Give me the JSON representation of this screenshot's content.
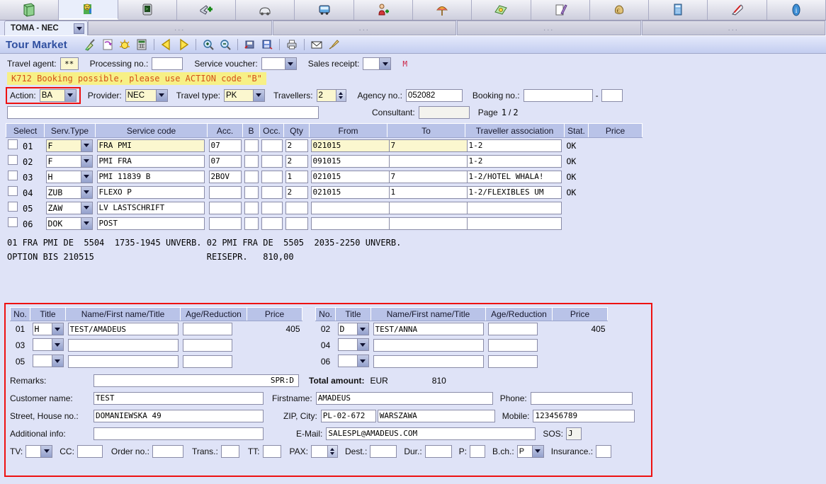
{
  "icon_tabs": [
    {
      "name": "briefcase-icon",
      "active": false
    },
    {
      "name": "smiley-figure-icon",
      "active": true
    },
    {
      "name": "terminal-icon",
      "active": false
    },
    {
      "name": "airplane-add-icon",
      "active": false
    },
    {
      "name": "car-rental-icon",
      "active": false
    },
    {
      "name": "bus-transfer-icon",
      "active": false
    },
    {
      "name": "person-add-icon",
      "active": false
    },
    {
      "name": "beach-umbrella-icon",
      "active": false
    },
    {
      "name": "money-bundle-icon",
      "active": false
    },
    {
      "name": "pen-document-icon",
      "active": false
    },
    {
      "name": "money-bag-euro-icon",
      "active": false
    },
    {
      "name": "book-icon",
      "active": false
    },
    {
      "name": "train-icon",
      "active": false
    },
    {
      "name": "info-icon",
      "active": false
    }
  ],
  "subtabs": {
    "main_label": "TOMA - NEC",
    "dots_label": "..."
  },
  "header": {
    "app_title": "Tour Market",
    "toolbar_icons": [
      {
        "name": "broom-clear-icon"
      },
      {
        "name": "undo-arrow-icon"
      },
      {
        "name": "sunburst-icon"
      },
      {
        "name": "calculator-icon"
      },
      {
        "name": "nav-back-icon"
      },
      {
        "name": "nav-forward-icon"
      },
      {
        "name": "zoom-in-icon"
      },
      {
        "name": "zoom-out-icon"
      },
      {
        "name": "open-file-icon"
      },
      {
        "name": "save-file-icon"
      },
      {
        "name": "print-icon"
      },
      {
        "name": "email-icon"
      },
      {
        "name": "brush-icon"
      }
    ]
  },
  "top_form": {
    "travel_agent_label": "Travel agent:",
    "travel_agent_value": "**",
    "processing_no_label": "Processing no.:",
    "processing_no_value": "",
    "service_voucher_label": "Service voucher:",
    "service_voucher_value": "",
    "sales_receipt_label": "Sales receipt:",
    "sales_receipt_value": "",
    "m_flag": "M"
  },
  "message": "K712 Booking possible, please use ACTION code \"B\"",
  "action_row": {
    "action_label": "Action:",
    "action_value": "BA",
    "provider_label": "Provider:",
    "provider_value": "NEC",
    "travel_type_label": "Travel type:",
    "travel_type_value": "PK",
    "travellers_label": "Travellers:",
    "travellers_value": "2",
    "agency_no_label": "Agency no.:",
    "agency_no_value": "052082",
    "booking_no_label": "Booking no.:",
    "booking_no_value": "",
    "booking_no_suffix": "",
    "booking_no_dash": "-",
    "free_text_value": "",
    "consultant_label": "Consultant:",
    "consultant_value": "",
    "page_label": "Page",
    "page_current": "1",
    "page_sep": "/",
    "page_total": "2"
  },
  "service_table": {
    "columns": [
      "Select",
      "Serv.Type",
      "Service code",
      "Acc.",
      "B",
      "Occ.",
      "Qty",
      "From",
      "To",
      "Traveller association",
      "Stat.",
      "Price"
    ],
    "rows": [
      {
        "no": "01",
        "type": "F",
        "code": "FRA PMI",
        "acc": "07",
        "b": "",
        "occ": "",
        "qty": "2",
        "from": "021015",
        "to": "7",
        "assoc": "1-2",
        "stat": "OK",
        "price": ""
      },
      {
        "no": "02",
        "type": "F",
        "code": "PMI FRA",
        "acc": "07",
        "b": "",
        "occ": "",
        "qty": "2",
        "from": "091015",
        "to": "",
        "assoc": "1-2",
        "stat": "OK",
        "price": ""
      },
      {
        "no": "03",
        "type": "H",
        "code": "PMI 11839 B",
        "acc": "2BOV",
        "b": "",
        "occ": "",
        "qty": "1",
        "from": "021015",
        "to": "7",
        "assoc": "1-2/HOTEL WHALA!",
        "stat": "OK",
        "price": ""
      },
      {
        "no": "04",
        "type": "ZUB",
        "code": "FLEXO P",
        "acc": "",
        "b": "",
        "occ": "",
        "qty": "2",
        "from": "021015",
        "to": "1",
        "assoc": "1-2/FLEXIBLES UM",
        "stat": "OK",
        "price": ""
      },
      {
        "no": "05",
        "type": "ZAW",
        "code": "LV LASTSCHRIFT",
        "acc": "",
        "b": "",
        "occ": "",
        "qty": "",
        "from": "",
        "to": "",
        "assoc": "",
        "stat": "",
        "price": ""
      },
      {
        "no": "06",
        "type": "DOK",
        "code": "POST",
        "acc": "",
        "b": "",
        "occ": "",
        "qty": "",
        "from": "",
        "to": "",
        "assoc": "",
        "stat": "",
        "price": ""
      }
    ]
  },
  "info_lines": [
    "01 FRA PMI DE  5504  1735-1945 UNVERB. 02 PMI FRA DE  5505  2035-2250 UNVERB.",
    "OPTION BIS 210515                      REISEPR.   810,00"
  ],
  "traveller_panel": {
    "columns": [
      "No.",
      "Title",
      "Name/First name/Title",
      "Age/Reduction",
      "Price"
    ],
    "left_rows": [
      {
        "no": "01",
        "title": "H",
        "name": "TEST/AMADEUS",
        "age": "",
        "price": "405"
      },
      {
        "no": "03",
        "title": "",
        "name": "",
        "age": "",
        "price": ""
      },
      {
        "no": "05",
        "title": "",
        "name": "",
        "age": "",
        "price": ""
      }
    ],
    "right_rows": [
      {
        "no": "02",
        "title": "D",
        "name": "TEST/ANNA",
        "age": "",
        "price": "405"
      },
      {
        "no": "04",
        "title": "",
        "name": "",
        "age": "",
        "price": ""
      },
      {
        "no": "06",
        "title": "",
        "name": "",
        "age": "",
        "price": ""
      }
    ],
    "remarks_label": "Remarks:",
    "remarks_value": "SPR:D",
    "total_amount_label": "Total amount:",
    "total_currency": "EUR",
    "total_value": "810",
    "customer_name_label": "Customer name:",
    "customer_name_value": "TEST",
    "firstname_label": "Firstname:",
    "firstname_value": "AMADEUS",
    "phone_label": "Phone:",
    "phone_value": "",
    "street_label": "Street, House no.:",
    "street_value": "DOMANIEWSKA 49",
    "zip_city_label": "ZIP, City:",
    "zip_value": "PL-02-672",
    "city_value": "WARSZAWA",
    "mobile_label": "Mobile:",
    "mobile_value": "123456789",
    "additional_info_label": "Additional info:",
    "additional_info_value": "",
    "email_label": "E-Mail:",
    "email_value": "SALESPL@AMADEUS.COM",
    "sos_label": "SOS:",
    "sos_value": "J",
    "tv_label": "TV:",
    "tv_value": "",
    "cc_label": "CC:",
    "cc_value": "",
    "order_no_label": "Order no.:",
    "order_no_value": "",
    "trans_label": "Trans.:",
    "trans_value": "",
    "tt_label": "TT:",
    "tt_value": "",
    "pax_label": "PAX:",
    "pax_value": "",
    "dest_label": "Dest.:",
    "dest_value": "",
    "dur_label": "Dur.:",
    "dur_value": "",
    "p_label": "P:",
    "p_value": "",
    "bch_label": "B.ch.:",
    "bch_value": "P",
    "insurance_label": "Insurance.:",
    "insurance_value": ""
  },
  "colors": {
    "background": "#dfe3f7",
    "accent_title": "#2f4fa0",
    "header_row": "#b9c3e8",
    "message_bg": "#f7f086",
    "message_fg": "#d4521a",
    "highlight_border": "#ee1111",
    "field_yellow": "#fbf7cf"
  }
}
